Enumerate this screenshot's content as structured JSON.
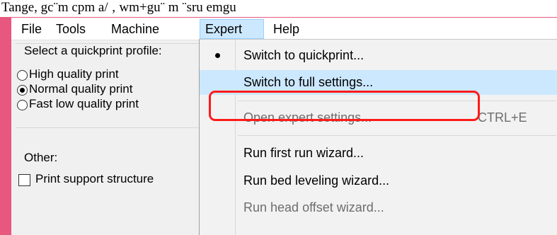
{
  "caption": "Tange, gc¨m cpm a/ ‚ wm+gu¨ m ¨sru emgu",
  "colors": {
    "frame": "#e8577f",
    "highlight": "#cce8ff",
    "annotation": "#ff1a1a"
  },
  "menubar": {
    "items": [
      {
        "label": "File"
      },
      {
        "label": "Tools"
      },
      {
        "label": "Machine"
      },
      {
        "label": "Expert",
        "active": true
      },
      {
        "label": "Help"
      }
    ]
  },
  "panel": {
    "quickprint_label": "Select a quickprint profile:",
    "options": [
      {
        "label": "High quality print",
        "selected": false
      },
      {
        "label": "Normal quality print",
        "selected": true
      },
      {
        "label": "Fast low quality print",
        "selected": false
      }
    ],
    "other_label": "Other:",
    "support_label": "Print support structure",
    "support_checked": false
  },
  "expert_menu": {
    "items": [
      {
        "label": "Switch to quickprint...",
        "bullet": true,
        "enabled": true
      },
      {
        "label": "Switch to full settings...",
        "enabled": true,
        "highlighted": true
      },
      {
        "label": "Open expert settings...",
        "shortcut": "CTRL+E",
        "enabled": false
      },
      {
        "label": "Run first run wizard...",
        "enabled": true
      },
      {
        "label": "Run bed leveling wizard...",
        "enabled": true
      },
      {
        "label": "Run head offset wizard...",
        "enabled": false
      }
    ]
  }
}
